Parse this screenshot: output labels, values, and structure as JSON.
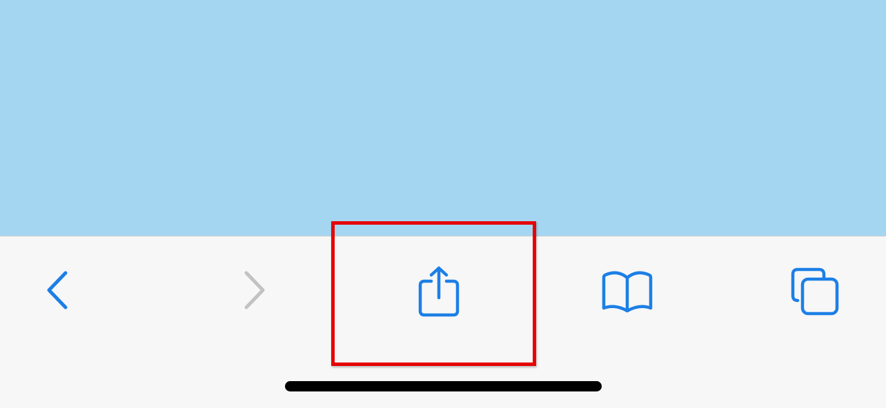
{
  "colors": {
    "content_background": "#a4d6f2",
    "toolbar_background": "#f7f7f7",
    "accent": "#1c7fe6",
    "disabled": "#c2c2c2",
    "highlight": "#e60000",
    "home_indicator": "#000000"
  },
  "toolbar": {
    "buttons": [
      {
        "icon": "chevron-left-icon",
        "state": "enabled"
      },
      {
        "icon": "chevron-right-icon",
        "state": "disabled"
      },
      {
        "icon": "share-icon",
        "state": "enabled",
        "highlighted": true
      },
      {
        "icon": "book-icon",
        "state": "enabled"
      },
      {
        "icon": "tabs-icon",
        "state": "enabled"
      }
    ]
  }
}
